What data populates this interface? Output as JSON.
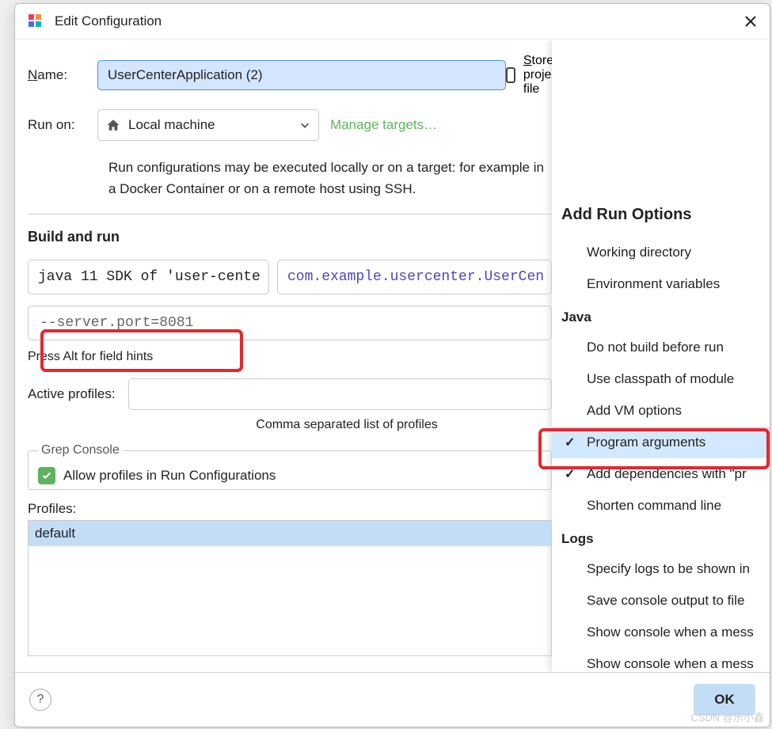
{
  "dialog": {
    "title": "Edit Configuration",
    "name_label_prefix": "N",
    "name_label_rest": "ame:",
    "name_value": "UserCenterApplication (2)",
    "store_label_prefix": "S",
    "store_label_rest": "tore as project file",
    "runon_label": "Run on:",
    "runon_value": "Local machine",
    "manage_targets": "Manage targets…",
    "description": "Run configurations may be executed locally or on a target: for example in a Docker Container or on a remote host using SSH.",
    "build_run_header": "Build and run",
    "sdk_value": "java 11 SDK of 'user-cente",
    "main_class_value": "com.example.usercenter.UserCen",
    "program_args_value": "--server.port=8081",
    "hint": "Press Alt for field hints",
    "active_profiles_label": "Active profiles:",
    "comma_hint": "Comma separated list of profiles",
    "grep_legend": "Grep Console",
    "allow_profiles": "Allow profiles in Run Configurations",
    "profiles_label": "Profiles:",
    "profiles_default": "default",
    "ok": "OK",
    "help": "?"
  },
  "options_panel": {
    "title": "Add Run Options",
    "items": [
      {
        "label": "Working directory",
        "checked": false
      },
      {
        "label": "Environment variables",
        "checked": false
      }
    ],
    "java_section": "Java",
    "java_items": [
      {
        "label": "Do not build before run",
        "checked": false
      },
      {
        "label": "Use classpath of module",
        "checked": false
      },
      {
        "label": "Add VM options",
        "checked": false
      },
      {
        "label": "Program arguments",
        "checked": true,
        "selected": true
      },
      {
        "label": "Add dependencies with \"pr",
        "checked": true
      },
      {
        "label": "Shorten command line",
        "checked": false
      }
    ],
    "logs_section": "Logs",
    "logs_items": [
      {
        "label": "Specify logs to be shown in",
        "checked": false
      },
      {
        "label": "Save console output to file",
        "checked": false
      },
      {
        "label": "Show console when a mess",
        "checked": false
      },
      {
        "label": "Show console when a mess",
        "checked": false
      }
    ]
  },
  "watermark": "CSDN @乐小鑫"
}
